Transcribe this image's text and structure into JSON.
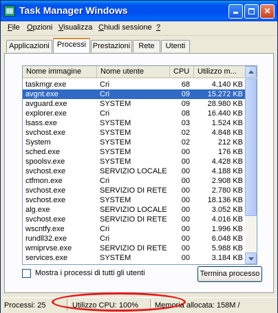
{
  "window": {
    "title": "Task Manager Windows"
  },
  "menu": [
    {
      "label": "File",
      "u": "F",
      "rest": "ile"
    },
    {
      "label": "Opzioni",
      "u": "O",
      "rest": "pzioni"
    },
    {
      "label": "Visualizza",
      "u": "V",
      "rest": "isualizza"
    },
    {
      "label": "Chiudi sessione",
      "u": "C",
      "rest": "hiudi sessione"
    },
    {
      "label": "?",
      "u": "?",
      "rest": ""
    }
  ],
  "tabs": [
    "Applicazioni",
    "Processi",
    "Prestazioni",
    "Rete",
    "Utenti"
  ],
  "active_tab": "Processi",
  "columns": [
    "Nome immagine",
    "Nome utente",
    "CPU",
    "Utilizzo m..."
  ],
  "processes": [
    {
      "name": "taskmgr.exe",
      "user": "Cri",
      "cpu": "68",
      "mem": "4.140 KB"
    },
    {
      "name": "avgnt.exe",
      "user": "Cri",
      "cpu": "09",
      "mem": "15.272 KB",
      "selected": true
    },
    {
      "name": "avguard.exe",
      "user": "SYSTEM",
      "cpu": "09",
      "mem": "28.980 KB"
    },
    {
      "name": "explorer.exe",
      "user": "Cri",
      "cpu": "08",
      "mem": "16.440 KB"
    },
    {
      "name": "lsass.exe",
      "user": "SYSTEM",
      "cpu": "03",
      "mem": "1.524 KB"
    },
    {
      "name": "svchost.exe",
      "user": "SYSTEM",
      "cpu": "02",
      "mem": "4.848 KB"
    },
    {
      "name": "System",
      "user": "SYSTEM",
      "cpu": "02",
      "mem": "212 KB"
    },
    {
      "name": "sched.exe",
      "user": "SYSTEM",
      "cpu": "00",
      "mem": "176 KB"
    },
    {
      "name": "spoolsv.exe",
      "user": "SYSTEM",
      "cpu": "00",
      "mem": "4.428 KB"
    },
    {
      "name": "svchost.exe",
      "user": "SERVIZIO LOCALE",
      "cpu": "00",
      "mem": "4.188 KB"
    },
    {
      "name": "ctfmon.exe",
      "user": "Cri",
      "cpu": "00",
      "mem": "2.908 KB"
    },
    {
      "name": "svchost.exe",
      "user": "SERVIZIO DI RETE",
      "cpu": "00",
      "mem": "2.780 KB"
    },
    {
      "name": "svchost.exe",
      "user": "SYSTEM",
      "cpu": "00",
      "mem": "18.136 KB"
    },
    {
      "name": "alg.exe",
      "user": "SERVIZIO LOCALE",
      "cpu": "00",
      "mem": "3.052 KB"
    },
    {
      "name": "svchost.exe",
      "user": "SERVIZIO DI RETE",
      "cpu": "00",
      "mem": "4.016 KB"
    },
    {
      "name": "wscntfy.exe",
      "user": "Cri",
      "cpu": "00",
      "mem": "1.996 KB"
    },
    {
      "name": "rundll32.exe",
      "user": "Cri",
      "cpu": "00",
      "mem": "6.048 KB"
    },
    {
      "name": "wmiprvse.exe",
      "user": "SERVIZIO DI RETE",
      "cpu": "00",
      "mem": "5.988 KB"
    },
    {
      "name": "services.exe",
      "user": "SYSTEM",
      "cpu": "00",
      "mem": "3.184 KB"
    }
  ],
  "show_all_label": "Mostra i processi di tutti gli utenti",
  "show_all_checked": false,
  "end_process_label": "Termina processo",
  "status": {
    "processes": "Processi: 25",
    "cpu": "Utilizzo CPU: 100%",
    "memory": "Memoria allocata: 158M /"
  },
  "colors": {
    "titlebar": "#0053ee",
    "selection": "#316ac5",
    "highlight_ellipse": "#e81717",
    "active_tab_accent": "#e68b2c"
  }
}
